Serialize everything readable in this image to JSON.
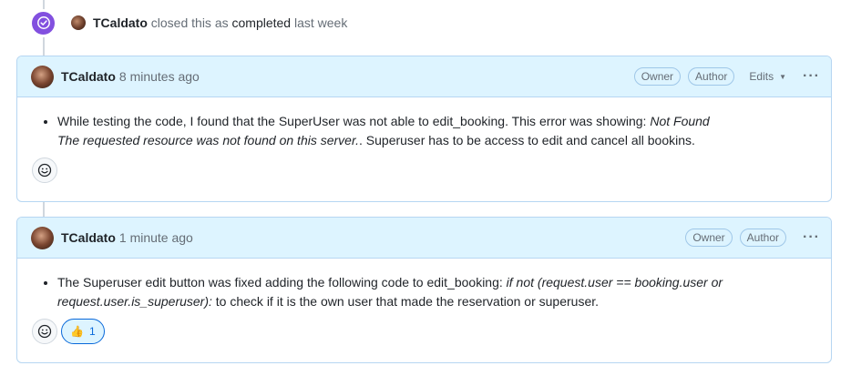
{
  "event": {
    "author": "TCaldato",
    "action": "closed this as",
    "state": "completed",
    "time": "last week",
    "icon": "check-circle-icon",
    "badge_color": "#8250df"
  },
  "comments": [
    {
      "author": "TCaldato",
      "time": "8 minutes ago",
      "labels": [
        "Owner",
        "Author"
      ],
      "edits_label": "Edits",
      "body_parts": {
        "p1": "While testing the code, I found that the SuperUser was not able to edit_booking. This error was showing: ",
        "em1": "Not Found",
        "em2": "The requested resource was not found on this server.",
        "p2": ". Superuser has to be access to edit and cancel all bookins."
      },
      "reactions": []
    },
    {
      "author": "TCaldato",
      "time": "1 minute ago",
      "labels": [
        "Owner",
        "Author"
      ],
      "body_parts": {
        "p1": "The Superuser edit button was fixed adding the following code to edit_booking: ",
        "em1": "if not (request.user == booking.user or request.user.is_superuser):",
        "p2": " to check if it is the own user that made the reservation or superuser."
      },
      "reactions": [
        {
          "emoji": "👍",
          "count": "1"
        }
      ]
    }
  ],
  "colors": {
    "header_bg": "#ddf4ff",
    "border": "#b6d6f2",
    "accent": "#0969da"
  }
}
